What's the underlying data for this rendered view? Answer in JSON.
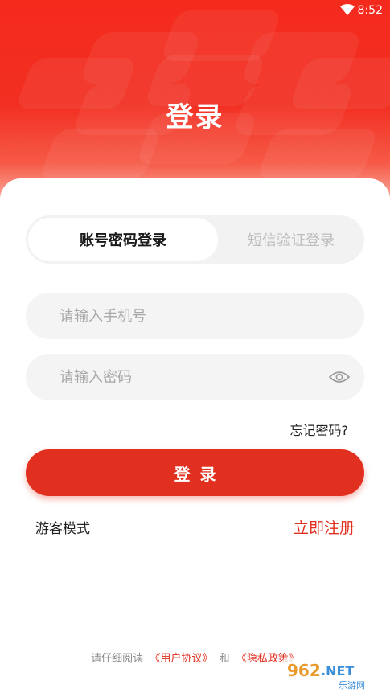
{
  "status_bar": {
    "time": "8:52"
  },
  "header": {
    "title": "登录"
  },
  "tabs": [
    {
      "label": "账号密码登录",
      "active": true
    },
    {
      "label": "短信验证登录",
      "active": false
    }
  ],
  "form": {
    "phone_placeholder": "请输入手机号",
    "phone_value": "",
    "password_placeholder": "请输入密码",
    "password_value": "",
    "forgot_label": "忘记密码?",
    "login_label": "登录"
  },
  "links": {
    "guest_label": "游客模式",
    "register_label": "立即注册"
  },
  "agreement": {
    "prefix": "请仔细阅读",
    "user_agreement": "《用户协议》",
    "and": "和",
    "privacy_policy": "《隐私政策》"
  },
  "watermark": {
    "text": "962.NET",
    "subtext": "乐游网"
  },
  "colors": {
    "accent": "#e1301f",
    "header_red": "#f42a1d",
    "field_bg": "#f4f4f4",
    "tab_inactive_text": "#bdbdbd"
  }
}
